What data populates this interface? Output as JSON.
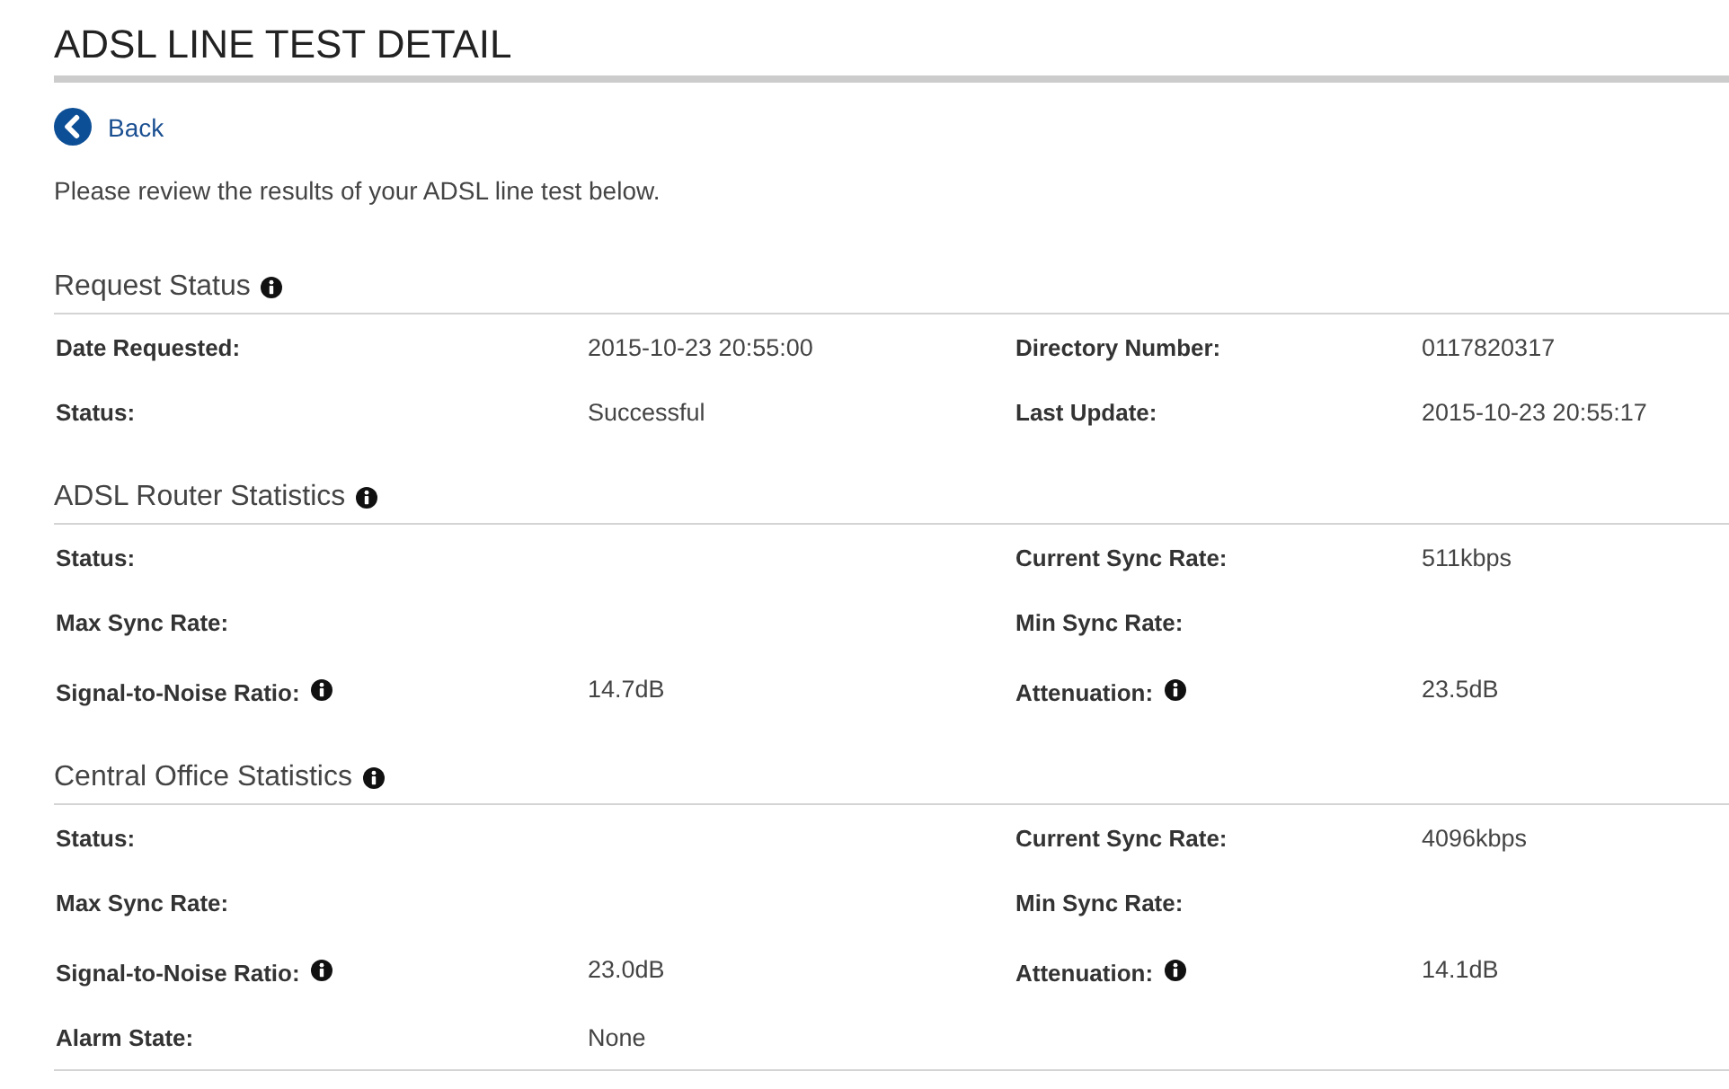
{
  "page": {
    "title": "ADSL LINE TEST DETAIL"
  },
  "back_link": {
    "label": "Back"
  },
  "intro": "Please review the results of your ADSL line test below.",
  "sections": [
    {
      "title": "Request Status",
      "info": true,
      "fields": [
        {
          "label": "Date Requested:",
          "info": false,
          "value": "2015-10-23 20:55:00"
        },
        {
          "label": "Directory Number:",
          "info": false,
          "value": "0117820317"
        },
        {
          "label": "Status:",
          "info": false,
          "value": "Successful"
        },
        {
          "label": "Last Update:",
          "info": false,
          "value": "2015-10-23 20:55:17"
        }
      ]
    },
    {
      "title": "ADSL Router Statistics",
      "info": true,
      "fields": [
        {
          "label": "Status:",
          "info": false
        },
        {
          "label": "Current Sync Rate:",
          "info": false,
          "value": "511kbps"
        },
        {
          "label": "Max Sync Rate:",
          "info": false
        },
        {
          "label": "Min Sync Rate:",
          "info": false
        },
        {
          "label": "Signal-to-Noise Ratio:",
          "info": true,
          "value": "14.7dB"
        },
        {
          "label": "Attenuation:",
          "info": true,
          "value": "23.5dB"
        }
      ]
    },
    {
      "title": "Central Office Statistics",
      "info": true,
      "fields": [
        {
          "label": "Status:",
          "info": false
        },
        {
          "label": "Current Sync Rate:",
          "info": false,
          "value": "4096kbps"
        },
        {
          "label": "Max Sync Rate:",
          "info": false
        },
        {
          "label": "Min Sync Rate:",
          "info": false
        },
        {
          "label": "Signal-to-Noise Ratio:",
          "info": true,
          "value": "23.0dB"
        },
        {
          "label": "Attenuation:",
          "info": true,
          "value": "14.1dB"
        },
        {
          "label": "Alarm State:",
          "info": false,
          "value": "None"
        }
      ]
    }
  ]
}
